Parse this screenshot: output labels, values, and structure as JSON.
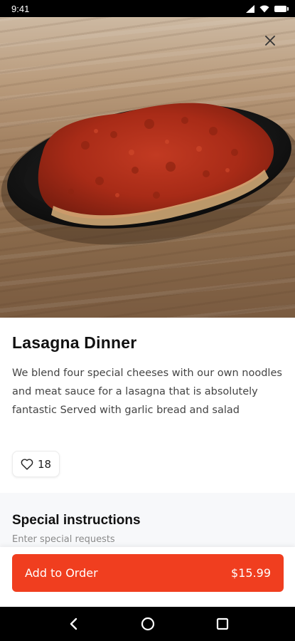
{
  "status_bar": {
    "time": "9:41"
  },
  "item": {
    "title": "Lasagna Dinner",
    "description": "We blend four special cheeses with our own noodles and meat sauce for a lasagna that is absolutely fantastic Served with garlic bread and salad",
    "likes": "18"
  },
  "special_instructions": {
    "title": "Special instructions",
    "placeholder": "Enter special requests"
  },
  "order_button": {
    "label": "Add to Order",
    "price": "$15.99"
  },
  "colors": {
    "accent": "#f03e1f"
  },
  "icons": [
    "close-icon",
    "heart-icon",
    "back-icon",
    "home-icon",
    "recents-icon"
  ]
}
